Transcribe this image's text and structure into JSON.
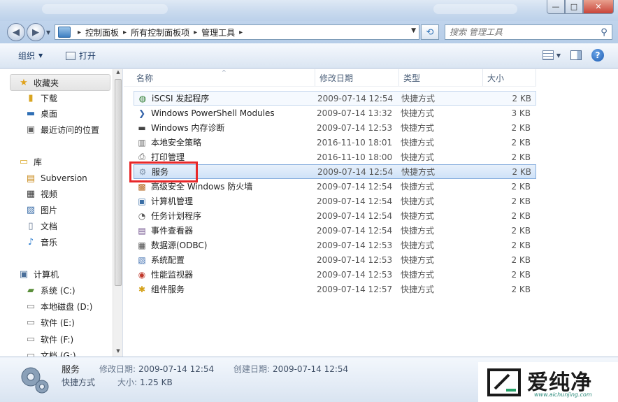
{
  "window": {
    "controls": {
      "minimize": "—",
      "maximize": "□",
      "close": "✕"
    }
  },
  "address": {
    "crumbs": [
      "控制面板",
      "所有控制面板项",
      "管理工具"
    ],
    "search_placeholder": "搜索 管理工具"
  },
  "toolbar": {
    "organize": "组织",
    "open": "打开"
  },
  "nav": {
    "favorites": "收藏夹",
    "favorites_items": [
      "下载",
      "桌面",
      "最近访问的位置"
    ],
    "libraries": "库",
    "libraries_items": [
      "Subversion",
      "视频",
      "图片",
      "文档",
      "音乐"
    ],
    "computer": "计算机",
    "computer_items": [
      "系统 (C:)",
      "本地磁盘 (D:)",
      "软件 (E:)",
      "软件 (F:)",
      "文档 (G:)"
    ]
  },
  "columns": {
    "name": "名称",
    "modified": "修改日期",
    "type": "类型",
    "size": "大小"
  },
  "files": [
    {
      "name": "iSCSI 发起程序",
      "modified": "2009-07-14 12:54",
      "type": "快捷方式",
      "size": "2 KB",
      "icon": "iscsi-icon",
      "color": "#2e7d32"
    },
    {
      "name": "Windows PowerShell Modules",
      "modified": "2009-07-14 13:32",
      "type": "快捷方式",
      "size": "3 KB",
      "icon": "powershell-icon",
      "color": "#2f5fa7"
    },
    {
      "name": "Windows 内存诊断",
      "modified": "2009-07-14 12:53",
      "type": "快捷方式",
      "size": "2 KB",
      "icon": "memory-diagnostic-icon",
      "color": "#444444"
    },
    {
      "name": "本地安全策略",
      "modified": "2016-11-10 18:01",
      "type": "快捷方式",
      "size": "2 KB",
      "icon": "security-policy-icon",
      "color": "#6b6b6b"
    },
    {
      "name": "打印管理",
      "modified": "2016-11-10 18:00",
      "type": "快捷方式",
      "size": "2 KB",
      "icon": "printer-icon",
      "color": "#555555"
    },
    {
      "name": "服务",
      "modified": "2009-07-14 12:54",
      "type": "快捷方式",
      "size": "2 KB",
      "icon": "services-gear-icon",
      "color": "#7a8fa8"
    },
    {
      "name": "高级安全 Windows 防火墙",
      "modified": "2009-07-14 12:54",
      "type": "快捷方式",
      "size": "2 KB",
      "icon": "firewall-icon",
      "color": "#b5651d"
    },
    {
      "name": "计算机管理",
      "modified": "2009-07-14 12:54",
      "type": "快捷方式",
      "size": "2 KB",
      "icon": "computer-management-icon",
      "color": "#3a6ea5"
    },
    {
      "name": "任务计划程序",
      "modified": "2009-07-14 12:54",
      "type": "快捷方式",
      "size": "2 KB",
      "icon": "task-scheduler-icon",
      "color": "#5a5a5a"
    },
    {
      "name": "事件查看器",
      "modified": "2009-07-14 12:54",
      "type": "快捷方式",
      "size": "2 KB",
      "icon": "event-viewer-icon",
      "color": "#6d4c8a"
    },
    {
      "name": "数据源(ODBC)",
      "modified": "2009-07-14 12:53",
      "type": "快捷方式",
      "size": "2 KB",
      "icon": "odbc-icon",
      "color": "#4d4d4d"
    },
    {
      "name": "系统配置",
      "modified": "2009-07-14 12:53",
      "type": "快捷方式",
      "size": "2 KB",
      "icon": "system-config-icon",
      "color": "#3f6fb0"
    },
    {
      "name": "性能监视器",
      "modified": "2009-07-14 12:53",
      "type": "快捷方式",
      "size": "2 KB",
      "icon": "performance-monitor-icon",
      "color": "#c0392b"
    },
    {
      "name": "组件服务",
      "modified": "2009-07-14 12:57",
      "type": "快捷方式",
      "size": "2 KB",
      "icon": "component-services-icon",
      "color": "#d4a017"
    }
  ],
  "details": {
    "name": "服务",
    "type": "快捷方式",
    "modified_label": "修改日期:",
    "modified": "2009-07-14 12:54",
    "created_label": "创建日期:",
    "created": "2009-07-14 12:54",
    "size_label": "大小:",
    "size": "1.25 KB"
  },
  "watermark": {
    "text": "爱纯净",
    "url": "www.aichunjing.com"
  }
}
